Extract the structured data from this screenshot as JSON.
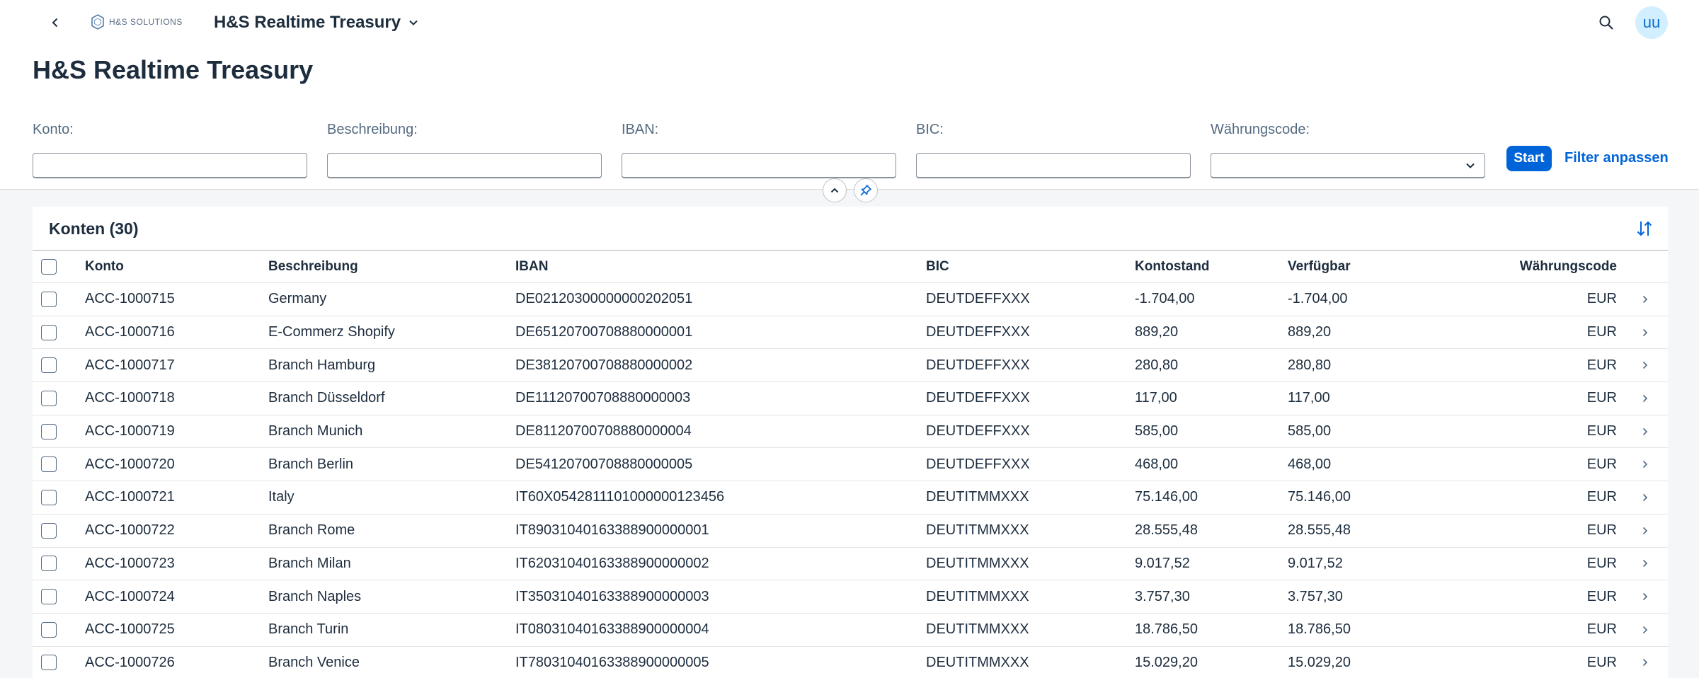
{
  "shell": {
    "logo_text": "H&S SOLUTIONS",
    "app_title": "H&S Realtime Treasury",
    "avatar_initials": "uu"
  },
  "page": {
    "title": "H&S Realtime Treasury"
  },
  "filters": {
    "konto": {
      "label": "Konto:",
      "value": ""
    },
    "beschreibung": {
      "label": "Beschreibung:",
      "value": ""
    },
    "iban": {
      "label": "IBAN:",
      "value": ""
    },
    "bic": {
      "label": "BIC:",
      "value": ""
    },
    "waehrungscode": {
      "label": "Währungscode:",
      "value": ""
    },
    "start_label": "Start",
    "adapt_label": "Filter anpassen"
  },
  "table": {
    "title": "Konten (30)",
    "columns": {
      "konto": "Konto",
      "beschreibung": "Beschreibung",
      "iban": "IBAN",
      "bic": "BIC",
      "kontostand": "Kontostand",
      "verfuegbar": "Verfügbar",
      "waehrungscode": "Währungscode"
    },
    "rows": [
      {
        "konto": "ACC-1000715",
        "beschreibung": "Germany",
        "iban": "DE02120300000000202051",
        "bic": "DEUTDEFFXXX",
        "kontostand": "-1.704,00",
        "verfuegbar": "-1.704,00",
        "waehrungscode": "EUR"
      },
      {
        "konto": "ACC-1000716",
        "beschreibung": "E-Commerz Shopify",
        "iban": "DE65120700708880000001",
        "bic": "DEUTDEFFXXX",
        "kontostand": "889,20",
        "verfuegbar": "889,20",
        "waehrungscode": "EUR"
      },
      {
        "konto": "ACC-1000717",
        "beschreibung": "Branch Hamburg",
        "iban": "DE38120700708880000002",
        "bic": "DEUTDEFFXXX",
        "kontostand": "280,80",
        "verfuegbar": "280,80",
        "waehrungscode": "EUR"
      },
      {
        "konto": "ACC-1000718",
        "beschreibung": "Branch Düsseldorf",
        "iban": "DE11120700708880000003",
        "bic": "DEUTDEFFXXX",
        "kontostand": "117,00",
        "verfuegbar": "117,00",
        "waehrungscode": "EUR"
      },
      {
        "konto": "ACC-1000719",
        "beschreibung": "Branch Munich",
        "iban": "DE81120700708880000004",
        "bic": "DEUTDEFFXXX",
        "kontostand": "585,00",
        "verfuegbar": "585,00",
        "waehrungscode": "EUR"
      },
      {
        "konto": "ACC-1000720",
        "beschreibung": "Branch Berlin",
        "iban": "DE54120700708880000005",
        "bic": "DEUTDEFFXXX",
        "kontostand": "468,00",
        "verfuegbar": "468,00",
        "waehrungscode": "EUR"
      },
      {
        "konto": "ACC-1000721",
        "beschreibung": "Italy",
        "iban": "IT60X0542811101000000123456",
        "bic": "DEUTITMMXXX",
        "kontostand": "75.146,00",
        "verfuegbar": "75.146,00",
        "waehrungscode": "EUR"
      },
      {
        "konto": "ACC-1000722",
        "beschreibung": "Branch Rome",
        "iban": "IT89031040163388900000001",
        "bic": "DEUTITMMXXX",
        "kontostand": "28.555,48",
        "verfuegbar": "28.555,48",
        "waehrungscode": "EUR"
      },
      {
        "konto": "ACC-1000723",
        "beschreibung": "Branch Milan",
        "iban": "IT62031040163388900000002",
        "bic": "DEUTITMMXXX",
        "kontostand": "9.017,52",
        "verfuegbar": "9.017,52",
        "waehrungscode": "EUR"
      },
      {
        "konto": "ACC-1000724",
        "beschreibung": "Branch Naples",
        "iban": "IT35031040163388900000003",
        "bic": "DEUTITMMXXX",
        "kontostand": "3.757,30",
        "verfuegbar": "3.757,30",
        "waehrungscode": "EUR"
      },
      {
        "konto": "ACC-1000725",
        "beschreibung": "Branch Turin",
        "iban": "IT08031040163388900000004",
        "bic": "DEUTITMMXXX",
        "kontostand": "18.786,50",
        "verfuegbar": "18.786,50",
        "waehrungscode": "EUR"
      },
      {
        "konto": "ACC-1000726",
        "beschreibung": "Branch Venice",
        "iban": "IT78031040163388900000005",
        "bic": "DEUTITMMXXX",
        "kontostand": "15.029,20",
        "verfuegbar": "15.029,20",
        "waehrungscode": "EUR"
      }
    ]
  },
  "colors": {
    "accent": "#0064d9",
    "text": "#1d2d3e",
    "avatar_bg": "#d1efff"
  }
}
